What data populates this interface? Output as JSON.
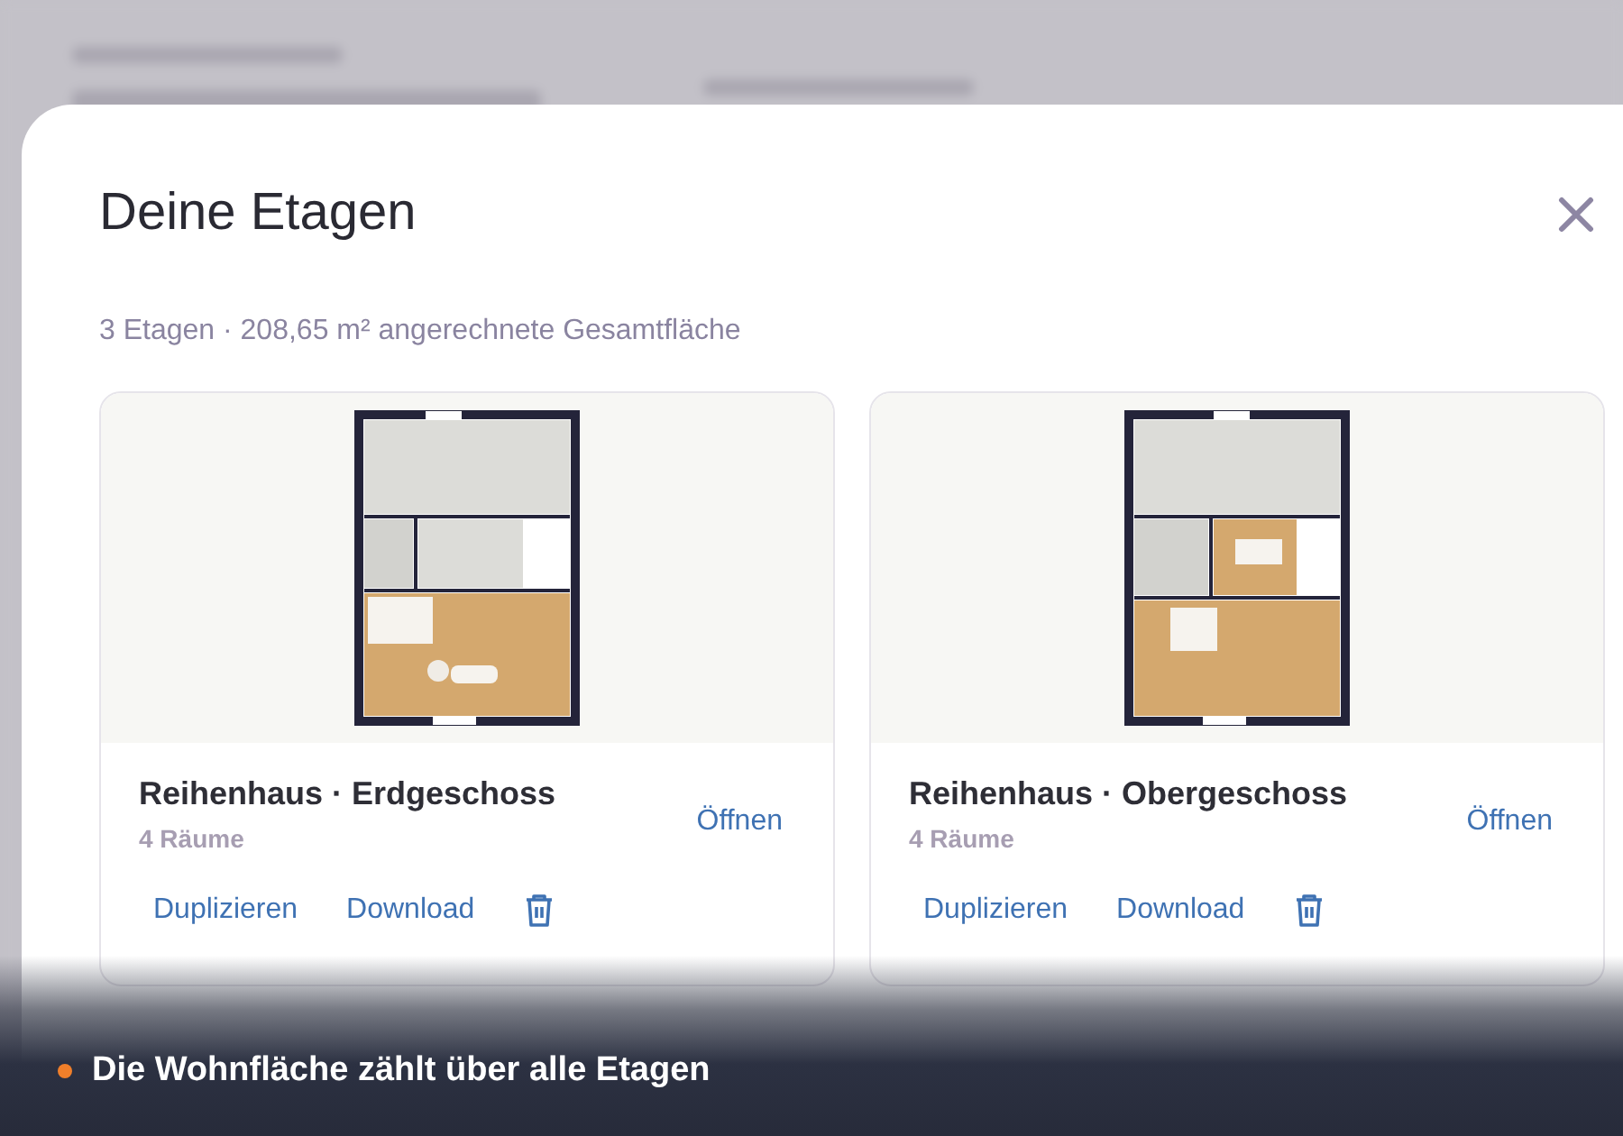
{
  "dialog": {
    "title": "Deine Etagen",
    "summary": "3 Etagen · 208,65 m² angerechnete Gesamtfläche"
  },
  "floors": [
    {
      "name": "Reihenhaus · Erdgeschoss",
      "rooms": "4 Räume",
      "open": "Öffnen",
      "duplicate": "Duplizieren",
      "download": "Download"
    },
    {
      "name": "Reihenhaus · Obergeschoss",
      "rooms": "4 Räume",
      "open": "Öffnen",
      "duplicate": "Duplizieren",
      "download": "Download"
    }
  ],
  "caption": {
    "text": "Die Wohnfläche zählt über alle Etagen"
  }
}
